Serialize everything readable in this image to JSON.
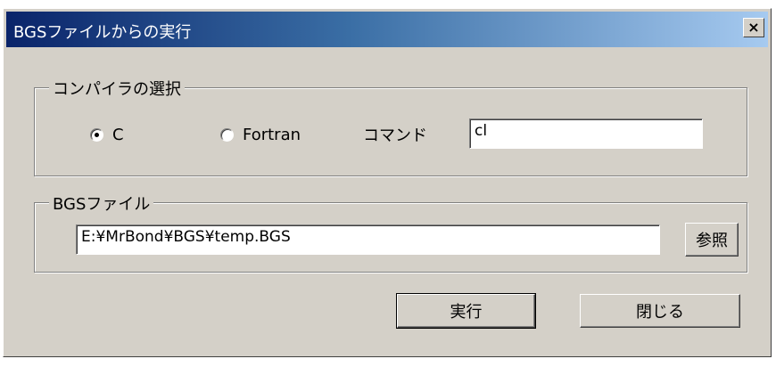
{
  "window": {
    "title": "BGSファイルからの実行",
    "close_symbol": "×"
  },
  "compiler_group": {
    "label": "コンパイラの選択",
    "options": [
      {
        "label": "C",
        "selected": true
      },
      {
        "label": "Fortran",
        "selected": false
      }
    ],
    "command_label": "コマンド",
    "command_value": "cl"
  },
  "bgs_group": {
    "label": "BGSファイル",
    "file_path": "E:¥MrBond¥BGS¥temp.BGS",
    "browse_label": "参照"
  },
  "buttons": {
    "run_label": "実行",
    "close_label": "閉じる"
  }
}
